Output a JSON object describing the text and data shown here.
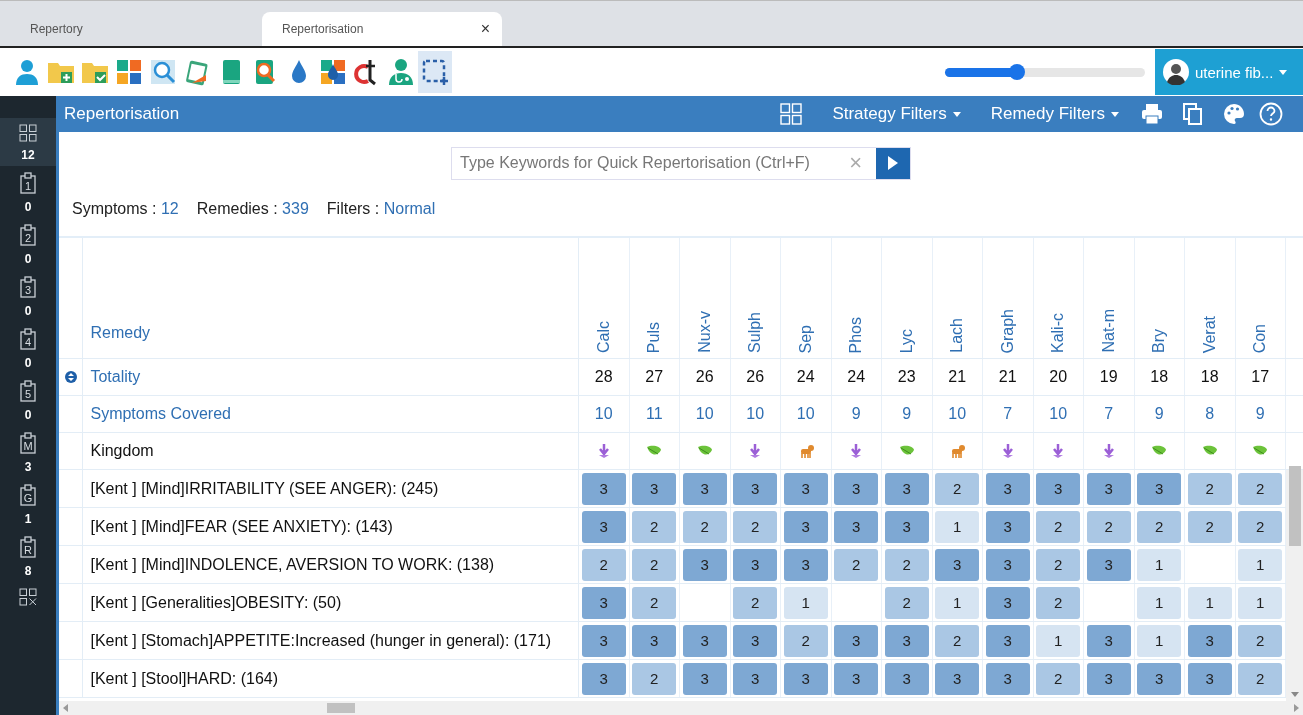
{
  "tabs": [
    {
      "label": "Repertory",
      "selected": false
    },
    {
      "label": "Repertorisation",
      "selected": true,
      "close": "×"
    }
  ],
  "toolbar": [
    {
      "kind": "person",
      "selected": false
    },
    {
      "kind": "folder-add",
      "selected": false
    },
    {
      "kind": "folder-check",
      "selected": false
    },
    {
      "kind": "tiles",
      "selected": false
    },
    {
      "kind": "tiles-search",
      "selected": false
    },
    {
      "kind": "clipboard",
      "selected": false
    },
    {
      "kind": "book",
      "selected": false
    },
    {
      "kind": "book-search",
      "selected": false
    },
    {
      "kind": "drop",
      "selected": false
    },
    {
      "kind": "tiles-drop",
      "selected": false
    },
    {
      "kind": "logo",
      "selected": false
    },
    {
      "kind": "doctor",
      "selected": false
    },
    {
      "kind": "select",
      "selected": true
    }
  ],
  "zoom_slider": {
    "level": 0.36
  },
  "case_button": {
    "label": "uterine fib..."
  },
  "sidebar": {
    "items": [
      {
        "kind": "grid",
        "count": "12",
        "selected": true
      },
      {
        "kind": "clip",
        "label": "1",
        "count": "0",
        "selected": false
      },
      {
        "kind": "clip",
        "label": "2",
        "count": "0",
        "selected": false
      },
      {
        "kind": "clip",
        "label": "3",
        "count": "0",
        "selected": false
      },
      {
        "kind": "clip",
        "label": "4",
        "count": "0",
        "selected": false
      },
      {
        "kind": "clip",
        "label": "5",
        "count": "0",
        "selected": false
      },
      {
        "kind": "clip",
        "label": "M",
        "count": "3",
        "selected": false
      },
      {
        "kind": "clip",
        "label": "G",
        "count": "1",
        "selected": false
      },
      {
        "kind": "clip",
        "label": "R",
        "count": "8",
        "selected": false
      },
      {
        "kind": "clear",
        "selected": false
      }
    ]
  },
  "header": {
    "title": "Repertorisation",
    "strategy": "Strategy Filters",
    "remedy": "Remedy Filters"
  },
  "search": {
    "placeholder": "Type Keywords for Quick Repertorisation (Ctrl+F)",
    "clear": "×"
  },
  "summary": [
    {
      "label": "Symptoms :",
      "value": "12"
    },
    {
      "label": "Remedies :",
      "value": "339"
    },
    {
      "label": "Filters :",
      "value": "Normal"
    }
  ],
  "table": {
    "first_column": "Remedy",
    "remedies": [
      {
        "name": "Calc",
        "totality": "28",
        "covered": "10",
        "kind": "mineral"
      },
      {
        "name": "Puls",
        "totality": "27",
        "covered": "11",
        "kind": "plant"
      },
      {
        "name": "Nux-v",
        "totality": "26",
        "covered": "10",
        "kind": "plant"
      },
      {
        "name": "Sulph",
        "totality": "26",
        "covered": "10",
        "kind": "mineral"
      },
      {
        "name": "Sep",
        "totality": "24",
        "covered": "10",
        "kind": "animal"
      },
      {
        "name": "Phos",
        "totality": "24",
        "covered": "9",
        "kind": "mineral"
      },
      {
        "name": "Lyc",
        "totality": "23",
        "covered": "9",
        "kind": "plant"
      },
      {
        "name": "Lach",
        "totality": "21",
        "covered": "10",
        "kind": "animal"
      },
      {
        "name": "Graph",
        "totality": "21",
        "covered": "7",
        "kind": "mineral"
      },
      {
        "name": "Kali-c",
        "totality": "20",
        "covered": "10",
        "kind": "mineral"
      },
      {
        "name": "Nat-m",
        "totality": "19",
        "covered": "7",
        "kind": "mineral"
      },
      {
        "name": "Bry",
        "totality": "18",
        "covered": "9",
        "kind": "plant"
      },
      {
        "name": "Verat",
        "totality": "18",
        "covered": "8",
        "kind": "plant"
      },
      {
        "name": "Con",
        "totality": "17",
        "covered": "9",
        "kind": "plant"
      }
    ],
    "totality_label": "Totality",
    "covered_label": "Symptoms Covered",
    "kingdom_label": "Kingdom",
    "rubrics": [
      {
        "text": "[Kent ] [Mind]IRRITABILITY (SEE ANGER): (245)",
        "grades": [
          {
            "grade": "3",
            "kind": "strong"
          },
          {
            "grade": "3",
            "kind": "strong"
          },
          {
            "grade": "3",
            "kind": "strong"
          },
          {
            "grade": "3",
            "kind": "strong"
          },
          {
            "grade": "3",
            "kind": "strong"
          },
          {
            "grade": "3",
            "kind": "strong"
          },
          {
            "grade": "3",
            "kind": "strong"
          },
          {
            "grade": "2",
            "kind": "medium"
          },
          {
            "grade": "3",
            "kind": "strong"
          },
          {
            "grade": "3",
            "kind": "strong"
          },
          {
            "grade": "3",
            "kind": "strong"
          },
          {
            "grade": "3",
            "kind": "strong"
          },
          {
            "grade": "2",
            "kind": "medium"
          },
          {
            "grade": "2",
            "kind": "medium"
          }
        ]
      },
      {
        "text": "[Kent ] [Mind]FEAR (SEE ANXIETY): (143)",
        "grades": [
          {
            "grade": "3",
            "kind": "strong"
          },
          {
            "grade": "2",
            "kind": "medium"
          },
          {
            "grade": "2",
            "kind": "medium"
          },
          {
            "grade": "2",
            "kind": "medium"
          },
          {
            "grade": "3",
            "kind": "strong"
          },
          {
            "grade": "3",
            "kind": "strong"
          },
          {
            "grade": "3",
            "kind": "strong"
          },
          {
            "grade": "1",
            "kind": "weak"
          },
          {
            "grade": "3",
            "kind": "strong"
          },
          {
            "grade": "2",
            "kind": "medium"
          },
          {
            "grade": "2",
            "kind": "medium"
          },
          {
            "grade": "2",
            "kind": "medium"
          },
          {
            "grade": "2",
            "kind": "medium"
          },
          {
            "grade": "2",
            "kind": "medium"
          }
        ]
      },
      {
        "text": "[Kent ] [Mind]INDOLENCE, AVERSION TO WORK: (138)",
        "grades": [
          {
            "grade": "2",
            "kind": "medium"
          },
          {
            "grade": "2",
            "kind": "medium"
          },
          {
            "grade": "3",
            "kind": "strong"
          },
          {
            "grade": "3",
            "kind": "strong"
          },
          {
            "grade": "3",
            "kind": "strong"
          },
          {
            "grade": "2",
            "kind": "medium"
          },
          {
            "grade": "2",
            "kind": "medium"
          },
          {
            "grade": "3",
            "kind": "strong"
          },
          {
            "grade": "3",
            "kind": "strong"
          },
          {
            "grade": "2",
            "kind": "medium"
          },
          {
            "grade": "3",
            "kind": "strong"
          },
          {
            "grade": "1",
            "kind": "weak"
          },
          {
            "kind": "empty"
          },
          {
            "grade": "1",
            "kind": "weak"
          }
        ]
      },
      {
        "text": "[Kent ] [Generalities]OBESITY: (50)",
        "grades": [
          {
            "grade": "3",
            "kind": "strong"
          },
          {
            "grade": "2",
            "kind": "medium"
          },
          {
            "kind": "empty"
          },
          {
            "grade": "2",
            "kind": "medium"
          },
          {
            "grade": "1",
            "kind": "weak"
          },
          {
            "kind": "empty"
          },
          {
            "grade": "2",
            "kind": "medium"
          },
          {
            "grade": "1",
            "kind": "weak"
          },
          {
            "grade": "3",
            "kind": "strong"
          },
          {
            "grade": "2",
            "kind": "medium"
          },
          {
            "kind": "empty"
          },
          {
            "grade": "1",
            "kind": "weak"
          },
          {
            "grade": "1",
            "kind": "weak"
          },
          {
            "grade": "1",
            "kind": "weak"
          }
        ]
      },
      {
        "text": "[Kent ] [Stomach]APPETITE:Increased (hunger in general): (171)",
        "grades": [
          {
            "grade": "3",
            "kind": "strong"
          },
          {
            "grade": "3",
            "kind": "strong"
          },
          {
            "grade": "3",
            "kind": "strong"
          },
          {
            "grade": "3",
            "kind": "strong"
          },
          {
            "grade": "2",
            "kind": "medium"
          },
          {
            "grade": "3",
            "kind": "strong"
          },
          {
            "grade": "3",
            "kind": "strong"
          },
          {
            "grade": "2",
            "kind": "medium"
          },
          {
            "grade": "3",
            "kind": "strong"
          },
          {
            "grade": "1",
            "kind": "weak"
          },
          {
            "grade": "3",
            "kind": "strong"
          },
          {
            "grade": "1",
            "kind": "weak"
          },
          {
            "grade": "3",
            "kind": "strong"
          },
          {
            "grade": "2",
            "kind": "medium"
          }
        ]
      },
      {
        "text": "[Kent ] [Stool]HARD: (164)",
        "grades": [
          {
            "grade": "3",
            "kind": "strong"
          },
          {
            "grade": "2",
            "kind": "medium"
          },
          {
            "grade": "3",
            "kind": "strong"
          },
          {
            "grade": "3",
            "kind": "strong"
          },
          {
            "grade": "3",
            "kind": "strong"
          },
          {
            "grade": "3",
            "kind": "strong"
          },
          {
            "grade": "3",
            "kind": "strong"
          },
          {
            "grade": "3",
            "kind": "strong"
          },
          {
            "grade": "3",
            "kind": "strong"
          },
          {
            "grade": "2",
            "kind": "medium"
          },
          {
            "grade": "3",
            "kind": "strong"
          },
          {
            "grade": "3",
            "kind": "strong"
          },
          {
            "grade": "3",
            "kind": "strong"
          },
          {
            "grade": "2",
            "kind": "medium"
          }
        ]
      }
    ]
  }
}
